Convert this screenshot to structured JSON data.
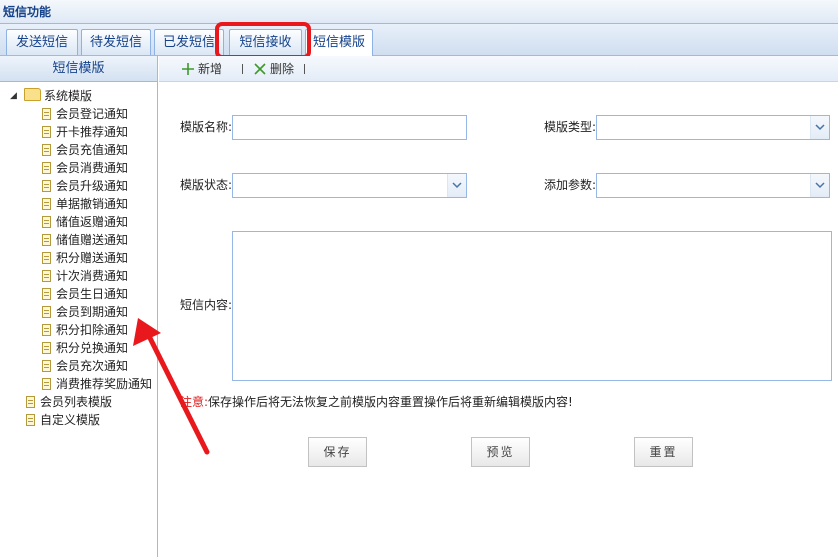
{
  "window": {
    "title": "短信功能"
  },
  "tabs": [
    {
      "label": "发送短信"
    },
    {
      "label": "待发短信"
    },
    {
      "label": "已发短信"
    },
    {
      "label": "短信接收"
    },
    {
      "label": "短信模版"
    }
  ],
  "sidebar": {
    "header": "短信模版",
    "tree": {
      "root": {
        "label": "系统模版",
        "expanded": true
      },
      "children": [
        "会员登记通知",
        "开卡推荐通知",
        "会员充值通知",
        "会员消费通知",
        "会员升级通知",
        "单据撤销通知",
        "储值返赠通知",
        "储值赠送通知",
        "积分赠送通知",
        "计次消费通知",
        "会员生日通知",
        "会员到期通知",
        "积分扣除通知",
        "积分兑换通知",
        "会员充次通知",
        "消费推荐奖励通知"
      ],
      "others": [
        "会员列表模版",
        "自定义模版"
      ]
    }
  },
  "toolbar": {
    "add_label": "新增",
    "delete_label": "删除"
  },
  "form": {
    "name_label": "模版名称:",
    "type_label": "模版类型:",
    "status_label": "模版状态:",
    "param_label": "添加参数:",
    "content_label": "短信内容:",
    "notice_prefix": "注意:",
    "notice_text": "保存操作后将无法恢复之前模版内容重置操作后将重新编辑模版内容!"
  },
  "buttons": {
    "save": "保存",
    "preview": "预览",
    "reset": "重置"
  },
  "colors": {
    "highlight": "#e8181c",
    "arrow": "#e8181c",
    "notice_red": "#e01b1b",
    "border_blue": "#99bbe8"
  },
  "icons": {
    "add": "plus-icon",
    "delete": "x-icon",
    "folder": "folder-icon",
    "document": "document-icon"
  }
}
